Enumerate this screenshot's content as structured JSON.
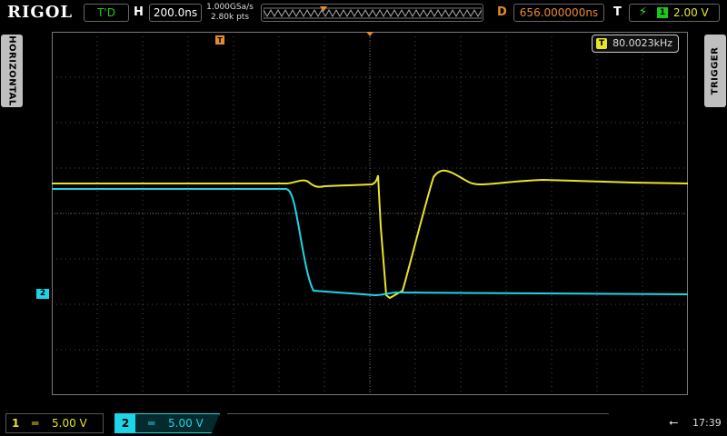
{
  "header": {
    "brand": "RIGOL",
    "run_mode": "T'D",
    "timebase_label": "H",
    "timebase": "200.0ns",
    "sample_rate": "1.000GSa/s",
    "memory_depth": "2.80k pts",
    "delay_label": "D",
    "delay": "656.000000ns",
    "trigger_label": "T",
    "trigger_source": "1",
    "trigger_level": "2.00 V",
    "colors": {
      "delay": "#e68a2e",
      "run_mode": "#1ecb1e"
    }
  },
  "side_tabs": {
    "left": "HORIZONTAL",
    "right": "TRIGGER"
  },
  "screen": {
    "frequency_counter": "80.0023kHz",
    "frequency_source": "T",
    "ch2_marker": "2"
  },
  "channels": [
    {
      "number": "1",
      "coupling": "═",
      "scale": "5.00 V",
      "color": "#e5e52a",
      "active": false
    },
    {
      "number": "2",
      "coupling": "═",
      "scale": "5.00 V",
      "color": "#1ed4e6",
      "active": true
    }
  ],
  "status": {
    "usb_icon": "usb-icon",
    "time": "17:39"
  }
}
